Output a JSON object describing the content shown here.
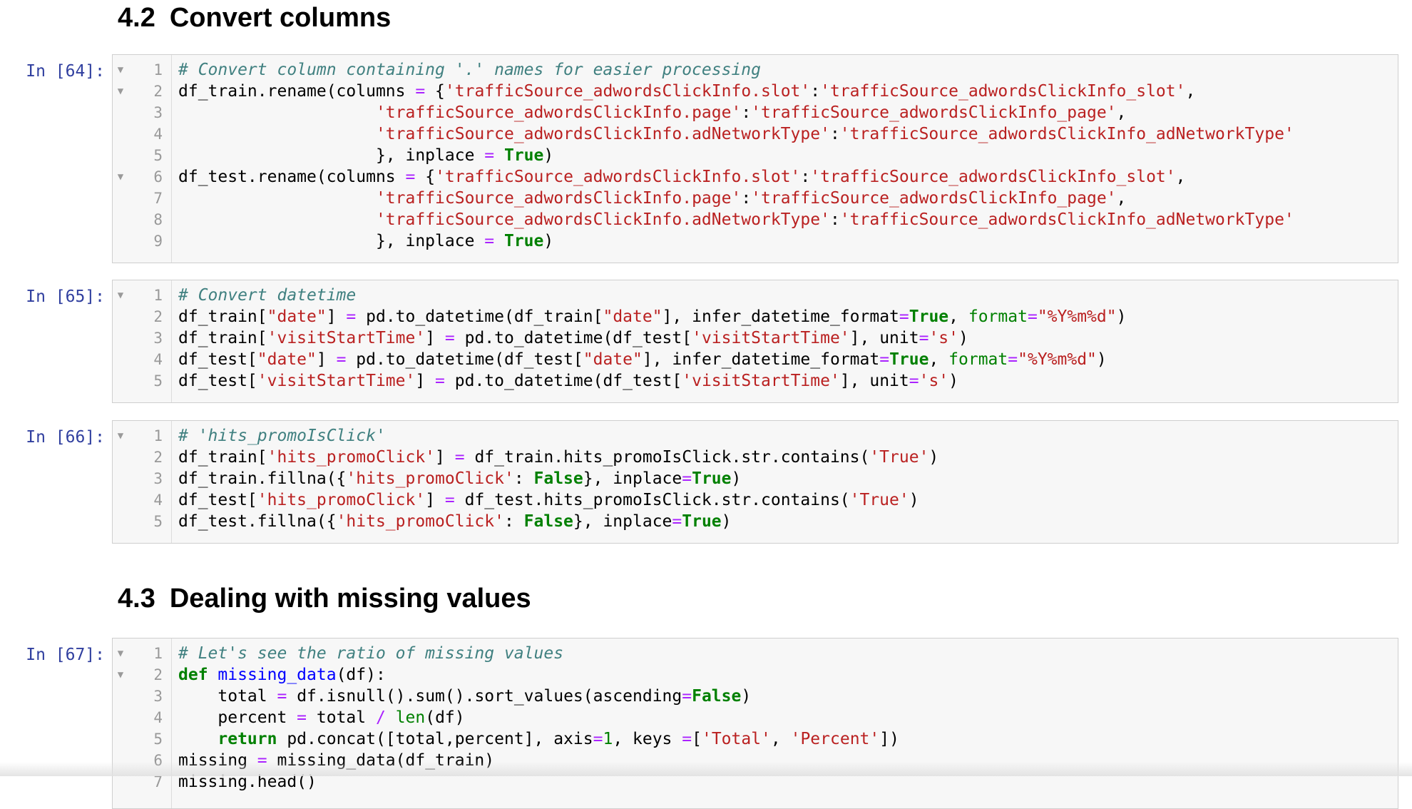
{
  "sections": {
    "s42": {
      "number": "4.2",
      "title": "Convert columns"
    },
    "s43": {
      "number": "4.3",
      "title": "Dealing with missing values"
    }
  },
  "cells": [
    {
      "prompt": "In [64]:",
      "folds": [
        1,
        2,
        6
      ],
      "lines": [
        [
          [
            "cm",
            "# Convert column containing '.' names for easier processing"
          ]
        ],
        [
          [
            "",
            "df_train.rename(columns "
          ],
          [
            "o",
            "="
          ],
          [
            "",
            " {"
          ],
          [
            "s",
            "'trafficSource_adwordsClickInfo.slot'"
          ],
          [
            "",
            ":"
          ],
          [
            "s",
            "'trafficSource_adwordsClickInfo_slot'"
          ],
          [
            "",
            ","
          ]
        ],
        [
          [
            "",
            "                    "
          ],
          [
            "s",
            "'trafficSource_adwordsClickInfo.page'"
          ],
          [
            "",
            ":"
          ],
          [
            "s",
            "'trafficSource_adwordsClickInfo_page'"
          ],
          [
            "",
            ","
          ]
        ],
        [
          [
            "",
            "                    "
          ],
          [
            "s",
            "'trafficSource_adwordsClickInfo.adNetworkType'"
          ],
          [
            "",
            ":"
          ],
          [
            "s",
            "'trafficSource_adwordsClickInfo_adNetworkType'"
          ]
        ],
        [
          [
            "",
            "                    }, inplace "
          ],
          [
            "o",
            "="
          ],
          [
            "",
            " "
          ],
          [
            "kw",
            "True"
          ],
          [
            "",
            ")"
          ]
        ],
        [
          [
            "",
            "df_test.rename(columns "
          ],
          [
            "o",
            "="
          ],
          [
            "",
            " {"
          ],
          [
            "s",
            "'trafficSource_adwordsClickInfo.slot'"
          ],
          [
            "",
            ":"
          ],
          [
            "s",
            "'trafficSource_adwordsClickInfo_slot'"
          ],
          [
            "",
            ","
          ]
        ],
        [
          [
            "",
            "                    "
          ],
          [
            "s",
            "'trafficSource_adwordsClickInfo.page'"
          ],
          [
            "",
            ":"
          ],
          [
            "s",
            "'trafficSource_adwordsClickInfo_page'"
          ],
          [
            "",
            ","
          ]
        ],
        [
          [
            "",
            "                    "
          ],
          [
            "s",
            "'trafficSource_adwordsClickInfo.adNetworkType'"
          ],
          [
            "",
            ":"
          ],
          [
            "s",
            "'trafficSource_adwordsClickInfo_adNetworkType'"
          ]
        ],
        [
          [
            "",
            "                    }, inplace "
          ],
          [
            "o",
            "="
          ],
          [
            "",
            " "
          ],
          [
            "kw",
            "True"
          ],
          [
            "",
            ")"
          ]
        ]
      ]
    },
    {
      "prompt": "In [65]:",
      "folds": [
        1
      ],
      "lines": [
        [
          [
            "cm",
            "# Convert datetime"
          ]
        ],
        [
          [
            "",
            "df_train["
          ],
          [
            "s",
            "\"date\""
          ],
          [
            "",
            "] "
          ],
          [
            "o",
            "="
          ],
          [
            "",
            " pd.to_datetime(df_train["
          ],
          [
            "s",
            "\"date\""
          ],
          [
            "",
            "], infer_datetime_format"
          ],
          [
            "o",
            "="
          ],
          [
            "kw",
            "True"
          ],
          [
            "",
            ", "
          ],
          [
            "nb",
            "format"
          ],
          [
            "o",
            "="
          ],
          [
            "s",
            "\"%Y%m%d\""
          ],
          [
            "",
            ")"
          ]
        ],
        [
          [
            "",
            "df_train["
          ],
          [
            "s",
            "'visitStartTime'"
          ],
          [
            "",
            "] "
          ],
          [
            "o",
            "="
          ],
          [
            "",
            " pd.to_datetime(df_test["
          ],
          [
            "s",
            "'visitStartTime'"
          ],
          [
            "",
            "], unit"
          ],
          [
            "o",
            "="
          ],
          [
            "s",
            "'s'"
          ],
          [
            "",
            ")"
          ]
        ],
        [
          [
            "",
            "df_test["
          ],
          [
            "s",
            "\"date\""
          ],
          [
            "",
            "] "
          ],
          [
            "o",
            "="
          ],
          [
            "",
            " pd.to_datetime(df_test["
          ],
          [
            "s",
            "\"date\""
          ],
          [
            "",
            "], infer_datetime_format"
          ],
          [
            "o",
            "="
          ],
          [
            "kw",
            "True"
          ],
          [
            "",
            ", "
          ],
          [
            "nb",
            "format"
          ],
          [
            "o",
            "="
          ],
          [
            "s",
            "\"%Y%m%d\""
          ],
          [
            "",
            ")"
          ]
        ],
        [
          [
            "",
            "df_test["
          ],
          [
            "s",
            "'visitStartTime'"
          ],
          [
            "",
            "] "
          ],
          [
            "o",
            "="
          ],
          [
            "",
            " pd.to_datetime(df_test["
          ],
          [
            "s",
            "'visitStartTime'"
          ],
          [
            "",
            "], unit"
          ],
          [
            "o",
            "="
          ],
          [
            "s",
            "'s'"
          ],
          [
            "",
            ")"
          ]
        ]
      ]
    },
    {
      "prompt": "In [66]:",
      "folds": [
        1
      ],
      "lines": [
        [
          [
            "cm",
            "# 'hits_promoIsClick'"
          ]
        ],
        [
          [
            "",
            "df_train["
          ],
          [
            "s",
            "'hits_promoClick'"
          ],
          [
            "",
            "] "
          ],
          [
            "o",
            "="
          ],
          [
            "",
            " df_train.hits_promoIsClick.str.contains("
          ],
          [
            "s",
            "'True'"
          ],
          [
            "",
            ")"
          ]
        ],
        [
          [
            "",
            "df_train.fillna({"
          ],
          [
            "s",
            "'hits_promoClick'"
          ],
          [
            "",
            ": "
          ],
          [
            "kw",
            "False"
          ],
          [
            "",
            "}, inplace"
          ],
          [
            "o",
            "="
          ],
          [
            "kw",
            "True"
          ],
          [
            "",
            ")"
          ]
        ],
        [
          [
            "",
            "df_test["
          ],
          [
            "s",
            "'hits_promoClick'"
          ],
          [
            "",
            "] "
          ],
          [
            "o",
            "="
          ],
          [
            "",
            " df_test.hits_promoIsClick.str.contains("
          ],
          [
            "s",
            "'True'"
          ],
          [
            "",
            ")"
          ]
        ],
        [
          [
            "",
            "df_test.fillna({"
          ],
          [
            "s",
            "'hits_promoClick'"
          ],
          [
            "",
            ": "
          ],
          [
            "kw",
            "False"
          ],
          [
            "",
            "}, inplace"
          ],
          [
            "o",
            "="
          ],
          [
            "kw",
            "True"
          ],
          [
            "",
            ")"
          ]
        ]
      ]
    },
    {
      "prompt": "In [67]:",
      "folds": [
        1,
        2
      ],
      "lines": [
        [
          [
            "cm",
            "# Let's see the ratio of missing values"
          ]
        ],
        [
          [
            "kw",
            "def"
          ],
          [
            "",
            " "
          ],
          [
            "nf",
            "missing_data"
          ],
          [
            "",
            "(df):"
          ]
        ],
        [
          [
            "",
            "    total "
          ],
          [
            "o",
            "="
          ],
          [
            "",
            " df.isnull().sum().sort_values(ascending"
          ],
          [
            "o",
            "="
          ],
          [
            "kw",
            "False"
          ],
          [
            "",
            ")"
          ]
        ],
        [
          [
            "",
            "    percent "
          ],
          [
            "o",
            "="
          ],
          [
            "",
            " total "
          ],
          [
            "o",
            "/"
          ],
          [
            "",
            " "
          ],
          [
            "nb",
            "len"
          ],
          [
            "",
            "(df)"
          ]
        ],
        [
          [
            "",
            "    "
          ],
          [
            "kw",
            "return"
          ],
          [
            "",
            " pd.concat([total,percent], axis"
          ],
          [
            "o",
            "="
          ],
          [
            "mi",
            "1"
          ],
          [
            "",
            ", keys "
          ],
          [
            "o",
            "="
          ],
          [
            "",
            "["
          ],
          [
            "s",
            "'Total'"
          ],
          [
            "",
            ", "
          ],
          [
            "s",
            "'Percent'"
          ],
          [
            "",
            "])"
          ]
        ],
        [
          [
            "",
            "missing "
          ],
          [
            "o",
            "="
          ],
          [
            "",
            " missing_data(df_train)"
          ]
        ],
        [
          [
            "",
            "missing.head()"
          ]
        ]
      ]
    }
  ]
}
